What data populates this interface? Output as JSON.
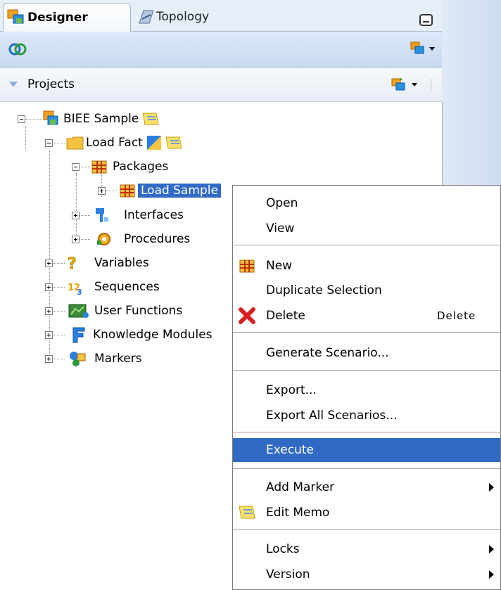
{
  "tabs": {
    "designer": "Designer",
    "topology": "Topology"
  },
  "projects_header": {
    "label": "Projects"
  },
  "tree": {
    "root": "BIEE Sample",
    "folder": "Load Fact",
    "packages": "Packages",
    "selected_package": "Load Sample",
    "interfaces": "Interfaces",
    "procedures": "Procedures",
    "variables": "Variables",
    "sequences": "Sequences",
    "user_functions": "User Functions",
    "knowledge_modules": "Knowledge Modules",
    "markers": "Markers"
  },
  "menu": {
    "open": "Open",
    "view": "View",
    "new": "New",
    "duplicate": "Duplicate Selection",
    "delete": "Delete",
    "delete_accel": "Delete",
    "generate": "Generate Scenario...",
    "export": "Export...",
    "export_all": "Export All Scenarios...",
    "execute": "Execute",
    "add_marker": "Add Marker",
    "edit_memo": "Edit Memo",
    "locks": "Locks",
    "version": "Version"
  },
  "colors": {
    "selection": "#316ac5",
    "toolbar": "#c9daf0"
  }
}
